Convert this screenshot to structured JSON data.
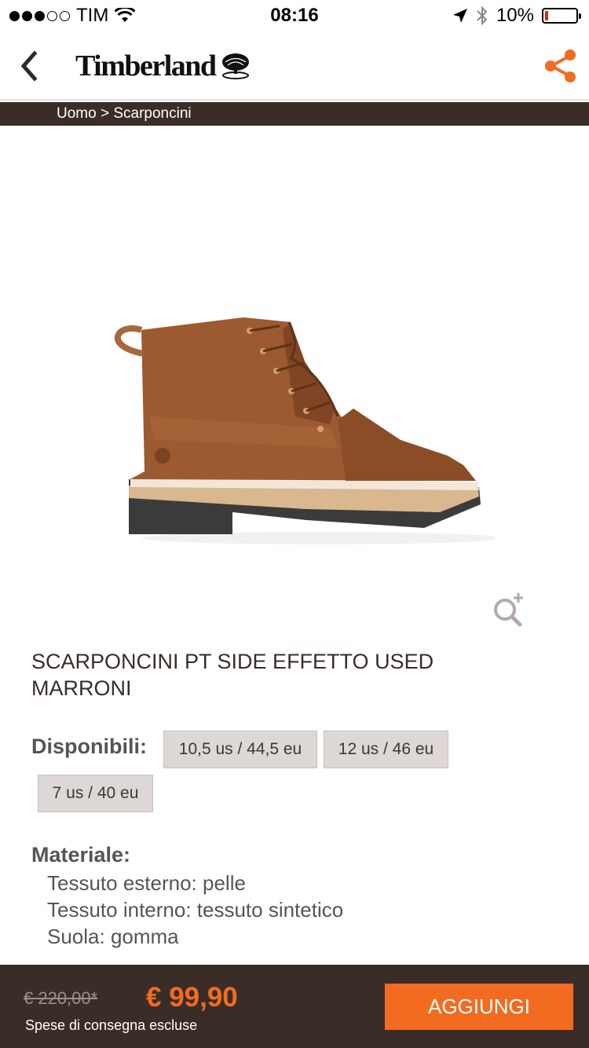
{
  "status_bar": {
    "carrier": "TIM",
    "time": "08:16",
    "battery_percent": "10%",
    "battery_level": 0.1,
    "signal_bars_filled": 3,
    "signal_bars_total": 5
  },
  "nav": {
    "logo_text": "Timberland",
    "back_icon": "chevron-left-icon",
    "share_icon": "share-icon",
    "accent_color": "#f26b21"
  },
  "breadcrumb": {
    "text": "Uomo > Scarponcini"
  },
  "product": {
    "title": "SCARPONCINI PT SIDE EFFETTO USED MARRONI",
    "availability_label": "Disponibili:",
    "sizes": [
      {
        "label": "10,5 us / 44,5 eu"
      },
      {
        "label": "12 us / 46 eu"
      },
      {
        "label": "7 us / 40 eu"
      }
    ],
    "material_label": "Materiale:",
    "materials": [
      "Tessuto esterno: pelle",
      "Tessuto interno: tessuto sintetico",
      "Suola: gomma"
    ],
    "zoom_icon": "zoom-in-icon"
  },
  "footer": {
    "old_price": "€ 220,00*",
    "new_price": "€ 99,90",
    "delivery_note": "Spese di consegna escluse",
    "add_button": "AGGIUNGI",
    "bar_color": "#3a2d28"
  }
}
